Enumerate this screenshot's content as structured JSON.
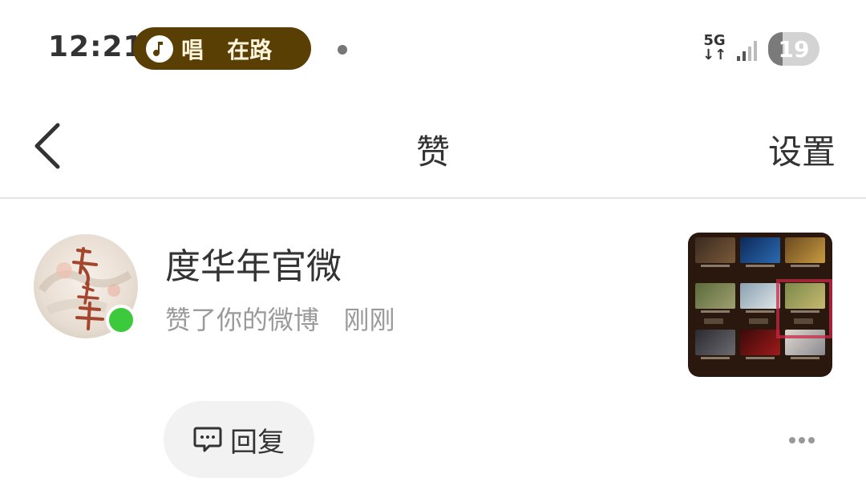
{
  "status_bar": {
    "time": "12:21",
    "music_text": "唱   在路",
    "network_top": "5G",
    "network_bottom": "↓↑",
    "battery": "19",
    "battery_level_percent": 19
  },
  "nav": {
    "title": "赞",
    "settings_label": "设置"
  },
  "notification": {
    "user_name": "度华年官微",
    "action": "赞了你的微博",
    "time": "刚刚",
    "online": true,
    "reply_label": "回复"
  },
  "colors": {
    "music_pill": "#5a3f05",
    "online": "#3cc93c",
    "secondary_text": "#9a9a9a"
  }
}
